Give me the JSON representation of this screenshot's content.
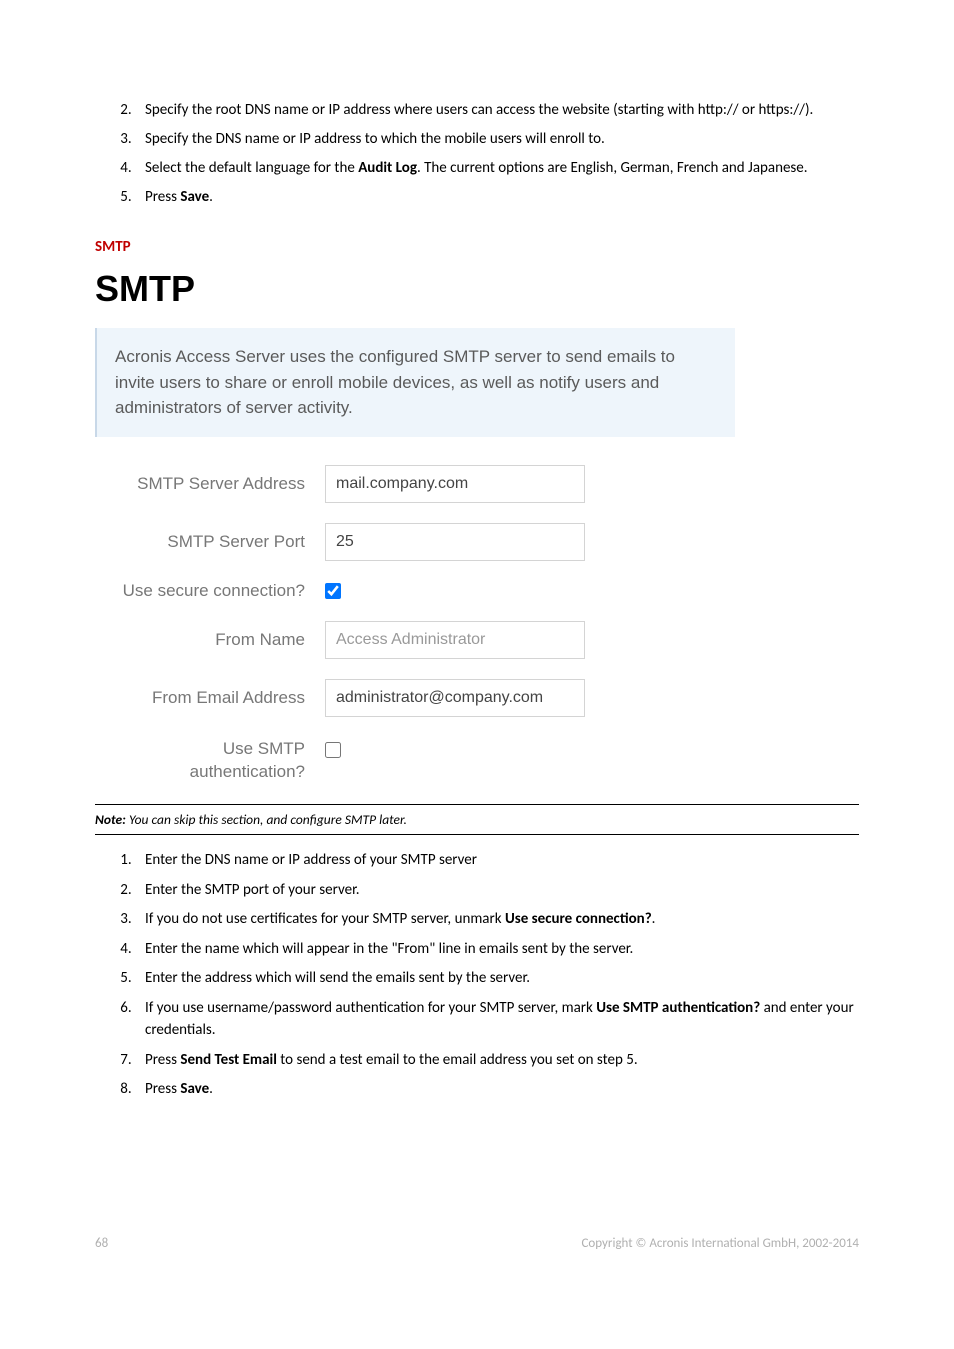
{
  "list1": {
    "i2": {
      "text_a": "Specify the root DNS name or IP address where users can access the website (starting with http:// or https://)."
    },
    "i3": {
      "text_a": "Specify the DNS name or IP address to which the mobile users will enroll to."
    },
    "i4": {
      "text_a": "Select the default language for the ",
      "bold": "Audit Log",
      "text_b": ". The current options are English, German, French and Japanese."
    },
    "i5": {
      "text_a": "Press ",
      "bold": "Save",
      "text_b": "."
    }
  },
  "section": {
    "smtp_heading": "SMTP"
  },
  "smtp": {
    "title": "SMTP",
    "info_text": "Acronis Access Server uses the configured SMTP server to send emails to invite users to share or enroll mobile devices, as well as notify users and administrators of server activity.",
    "labels": {
      "server_address": "SMTP Server Address",
      "server_port": "SMTP Server Port",
      "secure_conn": "Use secure connection?",
      "from_name": "From Name",
      "from_email": "From Email Address",
      "use_auth_line1": "Use SMTP",
      "use_auth_line2": "authentication?"
    },
    "values": {
      "server_address": "mail.company.com",
      "server_port": "25",
      "secure_conn": true,
      "from_name_placeholder": "Access Administrator",
      "from_email": "administrator@company.com",
      "use_auth": false
    }
  },
  "note": {
    "label": "Note:",
    "text": " You can skip this section, and configure SMTP later."
  },
  "list2": {
    "i1": {
      "text_a": "Enter the DNS name or IP address of your SMTP server"
    },
    "i2": {
      "text_a": "Enter the SMTP port of your server."
    },
    "i3": {
      "text_a": "If you do not use certificates for your SMTP server, unmark ",
      "bold": "Use secure connection?",
      "text_b": "."
    },
    "i4": {
      "text_a": "Enter the name which will appear in the \"From\" line in emails sent by the server."
    },
    "i5": {
      "text_a": "Enter the address which will send the emails sent by the server."
    },
    "i6": {
      "text_a": "If you use username/password authentication for your SMTP server, mark ",
      "bold": "Use SMTP authentication?",
      "text_b": " and enter your credentials."
    },
    "i7": {
      "text_a": "Press ",
      "bold": "Send Test Email",
      "text_b": " to send a test email to the email address you set on step 5."
    },
    "i8": {
      "text_a": "Press ",
      "bold": "Save",
      "text_b": "."
    }
  },
  "footer": {
    "page": "68",
    "copyright": "Copyright © Acronis International GmbH, 2002-2014"
  }
}
